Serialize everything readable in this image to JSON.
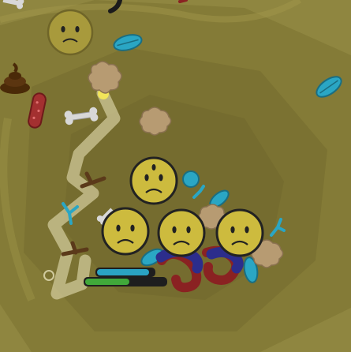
{
  "game": {
    "colors": {
      "ground_outer": "#8f8640",
      "ground_ring_1": "#847b37",
      "ground_ring_2": "#7b7232",
      "ground_ring_3": "#756c2f",
      "path_trail": "#d6cfa0",
      "face_fill": "#cdbb3e",
      "face_outline": "#222222",
      "leaf": "#2aa6c4",
      "dirt_clump": "#b79b72",
      "bone": "#d8d8d8",
      "poop": "#4a2a08",
      "worm_dark": "#2c2d8c",
      "worm_red": "#8a2222",
      "cursor_dot": "#f2e55a",
      "bar_blue": "#2aa3c3",
      "bar_green": "#41a83a"
    },
    "status_bars": {
      "upper_bar_level": 0.92,
      "lower_bar_level": 0.55
    },
    "units": [
      {
        "name": "neutral-face-unit",
        "expression": "sad"
      },
      {
        "name": "leader-face-unit",
        "expression": "sad",
        "marking": "third-eye"
      },
      {
        "name": "left-face-unit",
        "expression": "sad"
      },
      {
        "name": "middle-face-unit",
        "expression": "sad"
      },
      {
        "name": "right-face-unit",
        "expression": "sad"
      }
    ],
    "items": [
      "leaf-icon",
      "bone-icon",
      "dirt-clump-icon",
      "poop-icon",
      "red-pepper-icon",
      "stick-icon",
      "worm-icon",
      "feather-icon"
    ]
  }
}
